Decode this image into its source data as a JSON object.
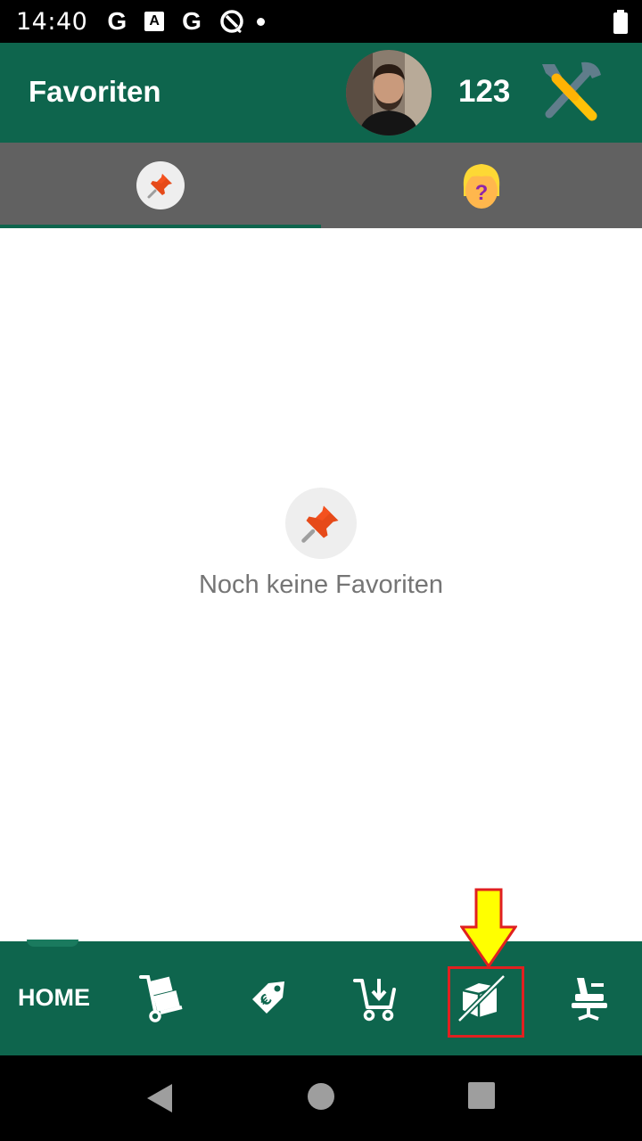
{
  "status_bar": {
    "time": "14:40",
    "icons": [
      "google-icon",
      "a-icon",
      "google-icon",
      "no-disturb-icon",
      "dot-icon",
      "battery-icon"
    ],
    "g_label": "G",
    "a_label": "A"
  },
  "app_bar": {
    "title": "Favoriten",
    "count": "123",
    "avatar": "profile-photo",
    "settings_icon": "tools-icon"
  },
  "tabs": [
    {
      "icon": "pushpin-icon",
      "selected": true
    },
    {
      "icon": "question-person-icon",
      "selected": false
    }
  ],
  "empty_state": {
    "icon": "pushpin-icon",
    "message": "Noch keine Favoriten"
  },
  "bottom_nav": {
    "home_label": "HOME",
    "items": [
      {
        "icon": "hand-truck-icon"
      },
      {
        "icon": "price-tag-icon"
      },
      {
        "icon": "cart-download-icon"
      },
      {
        "icon": "box-crossed-icon",
        "highlighted": true
      },
      {
        "icon": "chair-icon"
      }
    ]
  },
  "colors": {
    "primary": "#0e654d",
    "tab_background": "#616161",
    "highlight": "#e02020",
    "arrow": "#ffff00"
  }
}
